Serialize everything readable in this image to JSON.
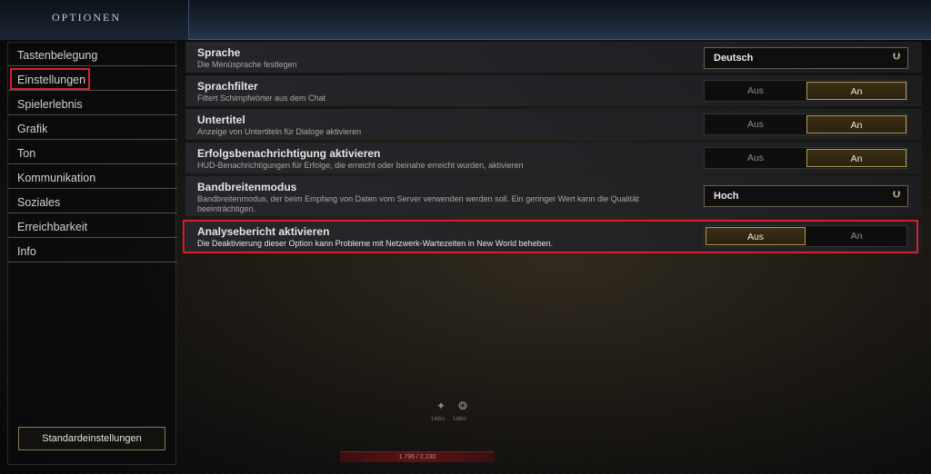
{
  "header": {
    "title": "OPTIONEN"
  },
  "sidebar": {
    "items": [
      {
        "label": "Tastenbelegung"
      },
      {
        "label": "Einstellungen"
      },
      {
        "label": "Spielerlebnis"
      },
      {
        "label": "Grafik"
      },
      {
        "label": "Ton"
      },
      {
        "label": "Kommunikation"
      },
      {
        "label": "Soziales"
      },
      {
        "label": "Erreichbarkeit"
      },
      {
        "label": "Info"
      }
    ],
    "selected": "Einstellungen",
    "reset_label": "Standardeinstellungen"
  },
  "settings": {
    "sprache": {
      "title": "Sprache",
      "desc": "Die Menüsprache festlegen",
      "value": "Deutsch"
    },
    "sprachfilter": {
      "title": "Sprachfilter",
      "desc": "Filtert Schimpfwörter aus dem Chat",
      "off": "Aus",
      "on": "An",
      "selected": "An"
    },
    "untertitel": {
      "title": "Untertitel",
      "desc": "Anzeige von Untertiteln für Dialoge aktivieren",
      "off": "Aus",
      "on": "An",
      "selected": "An"
    },
    "erfolg": {
      "title": "Erfolgsbenachrichtigung aktivieren",
      "desc": "HUD-Benachrichtigungen für Erfolge, die erreicht oder beinahe erreicht wurden, aktivieren",
      "off": "Aus",
      "on": "An",
      "selected": "An"
    },
    "bandbreite": {
      "title": "Bandbreitenmodus",
      "desc": "Bandbreitenmodus, der beim Empfang von Daten vom Server verwenden werden soll. Ein geringer Wert kann die Qualität beeinträchtigen.",
      "value": "Hoch"
    },
    "analyse": {
      "title": "Analysebericht aktivieren",
      "desc": "Die Deaktivierung dieser Option kann Probleme mit Netzwerk-Wartezeiten in New World beheben.",
      "off": "Aus",
      "on": "An",
      "selected": "Aus"
    }
  },
  "hud": {
    "left_text": "148m",
    "right_text": "148m",
    "bar_text": "1.796 / 2.230"
  },
  "colors": {
    "highlight": "#d6202e",
    "accent_gold": "#b79a52"
  }
}
